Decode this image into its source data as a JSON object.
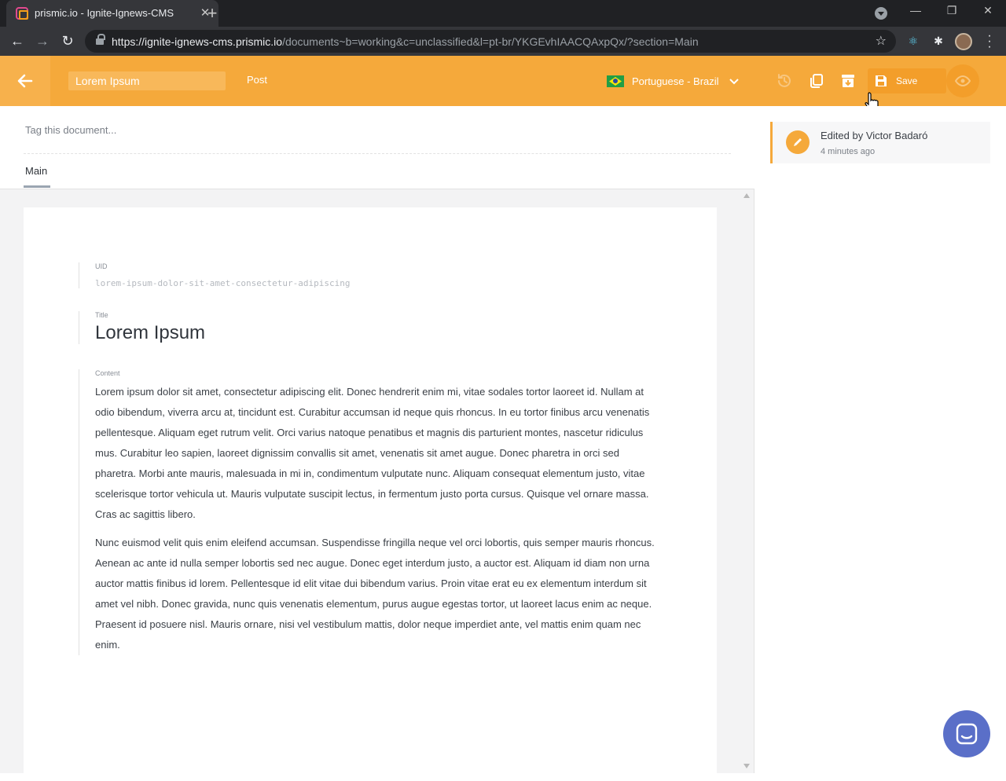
{
  "browser": {
    "tab_title": "prismic.io - Ignite-Ignews-CMS",
    "url_host": "https://ignite-ignews-cms.prismic.io",
    "url_path": "/documents~b=working&c=unclassified&l=pt-br/YKGEvhIAACQAxpQx/?section=Main"
  },
  "header": {
    "doc_title": "Lorem Ipsum",
    "doc_type": "Post",
    "language": "Portuguese - Brazil",
    "save_label": "Save"
  },
  "document": {
    "tag_placeholder": "Tag this document...",
    "tabs": [
      {
        "label": "Main"
      }
    ],
    "uid": {
      "label": "UID",
      "value": "lorem-ipsum-dolor-sit-amet-consectetur-adipiscing"
    },
    "title": {
      "label": "Title",
      "value": "Lorem Ipsum"
    },
    "content": {
      "label": "Content",
      "paragraphs": [
        "Lorem ipsum dolor sit amet, consectetur adipiscing elit. Donec hendrerit enim mi, vitae sodales tortor laoreet id. Nullam at odio bibendum, viverra arcu at, tincidunt est. Curabitur accumsan id neque quis rhoncus. In eu tortor finibus arcu venenatis pellentesque. Aliquam eget rutrum velit. Orci varius natoque penatibus et magnis dis parturient montes, nascetur ridiculus mus. Curabitur leo sapien, laoreet dignissim convallis sit amet, venenatis sit amet augue. Donec pharetra in orci sed pharetra. Morbi ante mauris, malesuada in mi in, condimentum vulputate nunc. Aliquam consequat elementum justo, vitae scelerisque tortor vehicula ut. Mauris vulputate suscipit lectus, in fermentum justo porta cursus. Quisque vel ornare massa. Cras ac sagittis libero.",
        "Nunc euismod velit quis enim eleifend accumsan. Suspendisse fringilla neque vel orci lobortis, quis semper mauris rhoncus. Aenean ac ante id nulla semper lobortis sed nec augue. Donec eget interdum justo, a auctor est. Aliquam id diam non urna auctor mattis finibus id lorem. Pellentesque id elit vitae dui bibendum varius. Proin vitae erat eu ex elementum interdum sit amet vel nibh. Donec gravida, nunc quis venenatis elementum, purus augue egestas tortor, ut laoreet lacus enim ac neque. Praesent id posuere nisl. Mauris ornare, nisi vel vestibulum mattis, dolor neque imperdiet ante, vel mattis enim quam nec enim."
      ]
    }
  },
  "activity": {
    "title": "Edited by Victor Badaró",
    "time": "4 minutes ago"
  },
  "colors": {
    "brand": "#f5a93b",
    "chat": "#5a6fc8"
  },
  "icons": [
    "back-arrow-icon",
    "history-icon",
    "duplicate-icon",
    "archive-icon",
    "save-icon",
    "eye-icon",
    "pencil-icon",
    "chat-icon"
  ]
}
